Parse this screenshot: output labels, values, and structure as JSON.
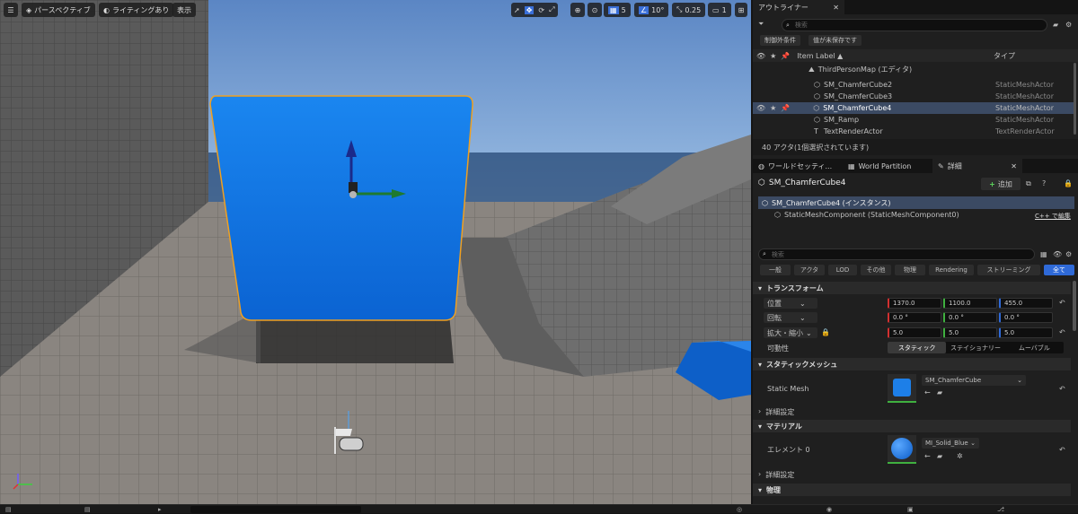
{
  "viewport": {
    "menu_icon": "hamburger-icon",
    "perspective_label": "パースペクティブ",
    "lighting_label": "ライティングあり",
    "show_label": "表示",
    "grid_snap_value": "5",
    "rotation_snap_value": "10°",
    "scale_snap_value": "0.25",
    "camera_speed_value": "1",
    "cube_color": "#0d6fe0",
    "cube_outline_color": "#f0a020"
  },
  "outliner": {
    "title": "アウトライナー",
    "search_placeholder": "検索",
    "buttons": [
      "制御外条件",
      "值が未保存です"
    ],
    "col_label": "Item Label ▲",
    "col_type": "タイプ",
    "root": "ThirdPersonMap (エディタ)",
    "items": [
      {
        "label": "SM_ChamferCube2",
        "type": "StaticMeshActor"
      },
      {
        "label": "SM_ChamferCube3",
        "type": "StaticMeshActor"
      },
      {
        "label": "SM_ChamferCube4",
        "type": "StaticMeshActor"
      },
      {
        "label": "SM_Ramp",
        "type": "StaticMeshActor"
      },
      {
        "label": "TextRenderActor",
        "type": "TextRenderActor"
      }
    ],
    "status": "40 アクタ(1個選択されています)"
  },
  "details": {
    "tabs": [
      "ワールドセッティ...",
      "World Partition",
      "詳細"
    ],
    "actor_name": "SM_ChamferCube4",
    "add_label": "追加",
    "instance_label": "SM_ChamferCube4 (インスタンス)",
    "component_label": "StaticMeshComponent (StaticMeshComponent0)",
    "cpp_label": "C++ で編集",
    "search_placeholder": "検索",
    "filters": [
      "一般",
      "アクタ",
      "LOD",
      "その他",
      "物理",
      "Rendering",
      "ストリーミング",
      "全て"
    ],
    "transform_header": "トランスフォーム",
    "location_label": "位置",
    "rotation_label": "回転",
    "scale_label": "拡大・縮小",
    "location": [
      "1370.0",
      "1100.0",
      "455.0"
    ],
    "rotation": [
      "0.0 °",
      "0.0 °",
      "0.0 °"
    ],
    "scale": [
      "5.0",
      "5.0",
      "5.0"
    ],
    "mobility_label": "可動性",
    "mobility_options": [
      "スタティック",
      "ステイショナリー",
      "ムーバブル"
    ],
    "static_mesh_header": "スタティックメッシュ",
    "static_mesh_label": "Static Mesh",
    "static_mesh_value": "SM_ChamferCube",
    "advanced_label": "詳細設定",
    "material_header": "マテリアル",
    "element_label": "エレメント 0",
    "material_value": "MI_Solid_Blue",
    "advanced_label2": "詳細設定",
    "physics_header": "物理"
  }
}
